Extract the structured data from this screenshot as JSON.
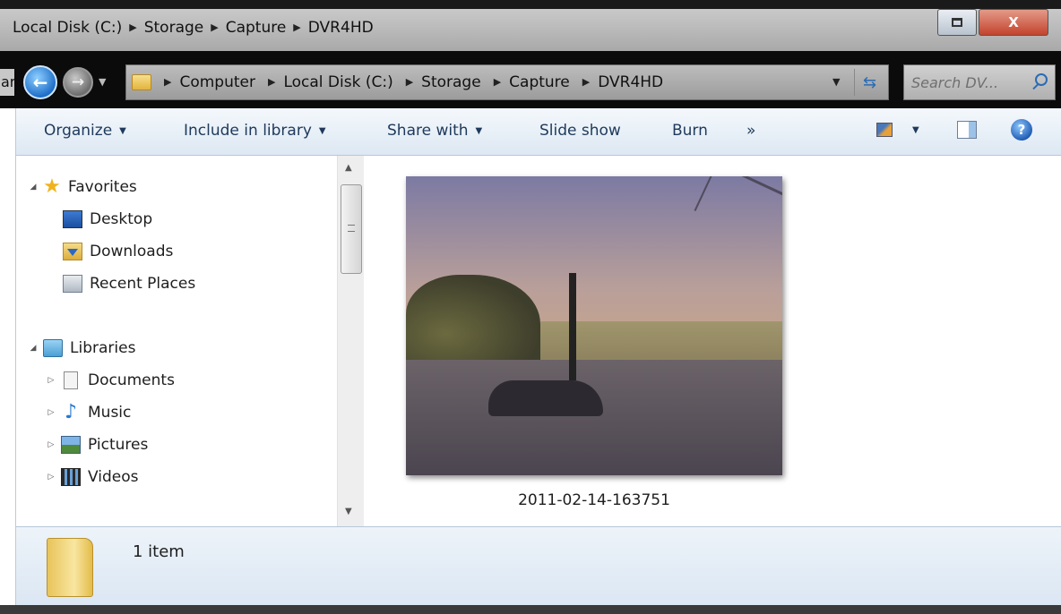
{
  "window": {
    "title_path": [
      "Local Disk (C:)",
      "Storage",
      "Capture",
      "DVR4HD"
    ],
    "restore_glyph": "restore-icon",
    "close_label": "X"
  },
  "address": {
    "cut_text": "ar",
    "crumbs": [
      "Computer",
      "Local Disk (C:)",
      "Storage",
      "Capture",
      "DVR4HD"
    ]
  },
  "search": {
    "placeholder": "Search DV..."
  },
  "commands": {
    "organize": "Organize",
    "include_in_library": "Include in library",
    "share_with": "Share with",
    "slide_show": "Slide show",
    "burn": "Burn",
    "more": "»",
    "help": "?"
  },
  "nav": {
    "favorites": {
      "label": "Favorites",
      "items": [
        "Desktop",
        "Downloads",
        "Recent Places"
      ]
    },
    "libraries": {
      "label": "Libraries",
      "items": [
        "Documents",
        "Music",
        "Pictures",
        "Videos"
      ]
    }
  },
  "files": [
    {
      "name": "2011-02-14-163751",
      "type": "image-thumbnail"
    }
  ],
  "status": {
    "item_count": "1 item"
  },
  "colors": {
    "accent": "#1e395b",
    "title_bar": "#b9b9b9",
    "close_button": "#c3432c",
    "command_bar": "#e8f0f8"
  }
}
